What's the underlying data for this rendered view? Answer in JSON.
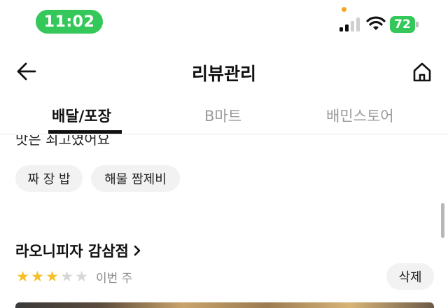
{
  "status_bar": {
    "time": "11:02",
    "battery": "72",
    "accent_color": "#34c759"
  },
  "header": {
    "title": "리뷰관리",
    "back_icon": "arrow-left-icon",
    "home_icon": "home-icon"
  },
  "tabs": [
    {
      "label": "배달/포장",
      "active": true
    },
    {
      "label": "B마트",
      "active": false
    },
    {
      "label": "배민스토어",
      "active": false
    }
  ],
  "previous_review": {
    "text_partial": "맛은 최고였어요",
    "tags": [
      "짜 장 밥",
      "해물 짬제비"
    ]
  },
  "review": {
    "store_name": "라오니피자 감삼점",
    "rating": 3,
    "rating_max": 5,
    "date": "이번 주",
    "delete_label": "삭제"
  }
}
